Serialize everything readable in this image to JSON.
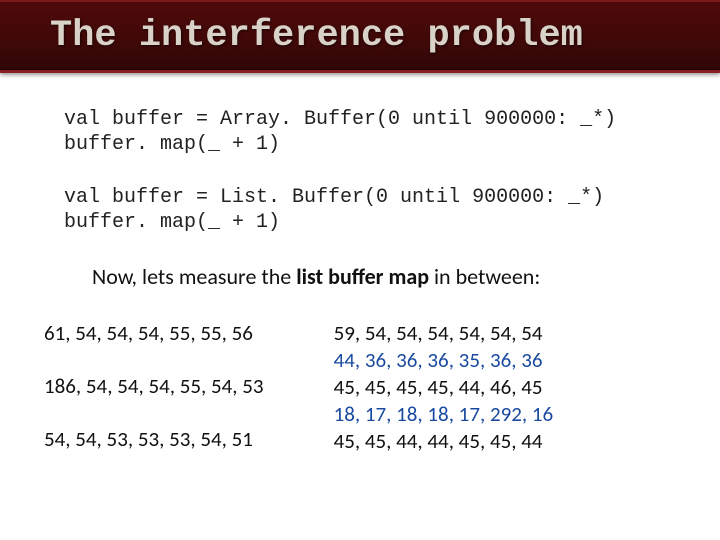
{
  "title": "The interference problem",
  "code1_line1": "val buffer = Array. Buffer(0 until 900000: _*)",
  "code1_line2": "buffer. map(_ + 1)",
  "code2_line1": "val buffer = List. Buffer(0 until 900000: _*)",
  "code2_line2": "buffer. map(_ + 1)",
  "subhead_pre": "Now, lets measure the ",
  "subhead_bold": "list buffer map",
  "subhead_post": " in between:",
  "left": {
    "r1": "61, 54, 54, 54, 55, 55, 56",
    "r2": "186, 54, 54, 54, 55, 54, 53",
    "r3": "54, 54, 53, 53, 53, 54, 51"
  },
  "right": {
    "r1": "59, 54, 54, 54, 54, 54, 54",
    "r2": "44, 36, 36, 36, 35, 36, 36",
    "r3": "45, 45, 45, 45, 44, 46, 45",
    "r4": "18, 17, 18, 18, 17, 292, 16",
    "r5": "45, 45, 44, 44, 45, 45, 44"
  }
}
